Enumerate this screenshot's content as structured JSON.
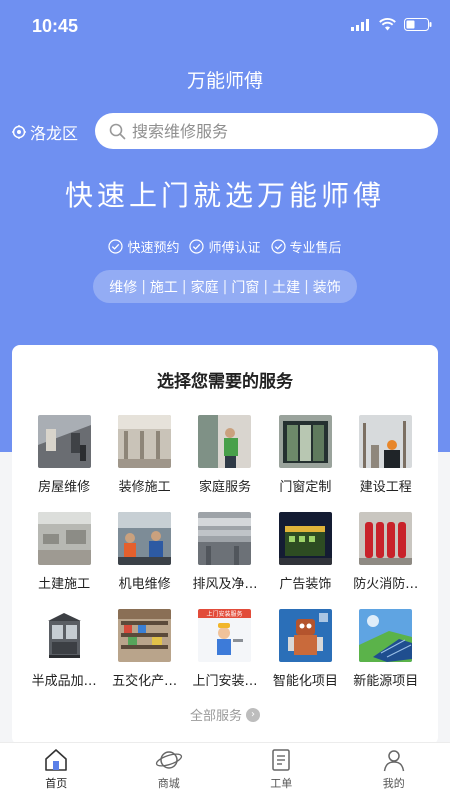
{
  "status": {
    "time": "10:45"
  },
  "header": {
    "title": "万能师傅"
  },
  "location": {
    "label": "洛龙区"
  },
  "search": {
    "placeholder": "搜索维修服务"
  },
  "hero": {
    "slogan": "快速上门就选万能师傅",
    "features": [
      "快速预约",
      "师傅认证",
      "专业售后"
    ],
    "tags": [
      "维修",
      "施工",
      "家庭",
      "门窗",
      "土建",
      "装饰"
    ]
  },
  "services": {
    "title": "选择您需要的服务",
    "items": [
      {
        "label": "房屋维修",
        "icon": "house-repair-thumb"
      },
      {
        "label": "装修施工",
        "icon": "renovation-thumb"
      },
      {
        "label": "家庭服务",
        "icon": "home-service-thumb"
      },
      {
        "label": "门窗定制",
        "icon": "window-door-thumb"
      },
      {
        "label": "建设工程",
        "icon": "construction-thumb"
      },
      {
        "label": "土建施工",
        "icon": "civil-works-thumb"
      },
      {
        "label": "机电维修",
        "icon": "mep-repair-thumb"
      },
      {
        "label": "排风及净…",
        "icon": "ventilation-thumb"
      },
      {
        "label": "广告装饰",
        "icon": "ad-decoration-thumb"
      },
      {
        "label": "防火消防…",
        "icon": "fire-protection-thumb"
      },
      {
        "label": "半成品加…",
        "icon": "semi-finished-thumb"
      },
      {
        "label": "五交化产…",
        "icon": "hardware-products-thumb"
      },
      {
        "label": "上门安装…",
        "icon": "onsite-install-thumb"
      },
      {
        "label": "智能化项目",
        "icon": "smart-project-thumb"
      },
      {
        "label": "新能源项目",
        "icon": "new-energy-thumb"
      }
    ],
    "all_label": "全部服务",
    "thumb_text": "上门安装服务"
  },
  "tabbar": {
    "items": [
      {
        "label": "首页",
        "icon": "home-icon",
        "active": true
      },
      {
        "label": "商城",
        "icon": "planet-icon",
        "active": false
      },
      {
        "label": "工单",
        "icon": "document-icon",
        "active": false
      },
      {
        "label": "我的",
        "icon": "person-icon",
        "active": false
      }
    ]
  },
  "colors": {
    "primary": "#6f90f1",
    "background": "#f4f5f7"
  }
}
